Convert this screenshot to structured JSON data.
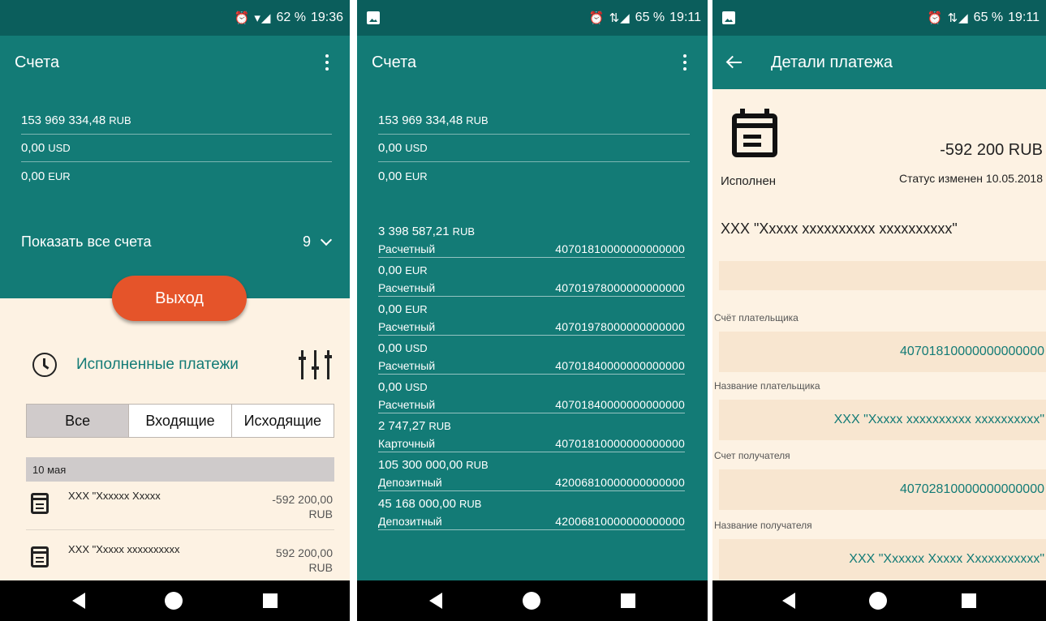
{
  "screen1": {
    "status": {
      "icons": "⏰ ▾◢",
      "battery": "62 %",
      "time": "19:36"
    },
    "appbar_title": "Счета",
    "accounts": [
      {
        "amount": "153 969 334,48",
        "currency": "RUB"
      },
      {
        "amount": "0,00",
        "currency": "USD"
      },
      {
        "amount": "0,00",
        "currency": "EUR"
      }
    ],
    "show_all_label": "Показать все счета",
    "show_all_count": "9",
    "exit_label": "Выход",
    "executed_label": "Исполненные платежи",
    "tabs": [
      "Все",
      "Входящие",
      "Исходящие"
    ],
    "date_header": "10 мая",
    "payments": [
      {
        "name": "XXX \"Xxxxxx Xxxxx",
        "amount": "-592 200,00",
        "currency": "RUB"
      },
      {
        "name": "XXX \"Xxxxx xxxxxxxxxx",
        "amount": "592 200,00",
        "currency": "RUB"
      }
    ]
  },
  "screen2": {
    "status": {
      "icons": "⏰ ⇅◢",
      "battery": "65 %",
      "time": "19:11"
    },
    "appbar_title": "Счета",
    "summary": [
      {
        "amount": "153 969 334,48",
        "currency": "RUB"
      },
      {
        "amount": "0,00",
        "currency": "USD"
      },
      {
        "amount": "0,00",
        "currency": "EUR"
      }
    ],
    "accounts": [
      {
        "amount": "3 398 587,21",
        "currency": "RUB",
        "type": "Расчетный",
        "number": "40701810000000000000"
      },
      {
        "amount": "0,00",
        "currency": "EUR",
        "type": "Расчетный",
        "number": "40701978000000000000"
      },
      {
        "amount": "0,00",
        "currency": "EUR",
        "type": "Расчетный",
        "number": "40701978000000000000"
      },
      {
        "amount": "0,00",
        "currency": "USD",
        "type": "Расчетный",
        "number": "40701840000000000000"
      },
      {
        "amount": "0,00",
        "currency": "USD",
        "type": "Расчетный",
        "number": "40701840000000000000"
      },
      {
        "amount": "2 747,27",
        "currency": "RUB",
        "type": "Карточный",
        "number": "40701810000000000000"
      },
      {
        "amount": "105 300 000,00",
        "currency": "RUB",
        "type": "Депозитный",
        "number": "42006810000000000000"
      },
      {
        "amount": "45 168 000,00",
        "currency": "RUB",
        "type": "Депозитный",
        "number": "42006810000000000000"
      }
    ]
  },
  "screen3": {
    "status": {
      "icons": "⏰ ⇅◢",
      "battery": "65 %",
      "time": "19:11"
    },
    "appbar_title": "Детали платежа",
    "amount": "-592 200 RUB",
    "status_label": "Исполнен",
    "status_changed": "Статус изменен 10.05.2018",
    "payer_title": "XXX \"Xxxxx xxxxxxxxxx xxxxxxxxxx\"",
    "fields": [
      {
        "label": "Счёт плательщика",
        "value": "40701810000000000000"
      },
      {
        "label": "Название плательщика",
        "value": "XXX \"Xxxxx xxxxxxxxxx xxxxxxxxxx\""
      },
      {
        "label": "Счет получателя",
        "value": "40702810000000000000"
      },
      {
        "label": "Название получателя",
        "value": "XXX \"Xxxxxx Xxxxx Xxxxxxxxxxx\""
      }
    ]
  }
}
